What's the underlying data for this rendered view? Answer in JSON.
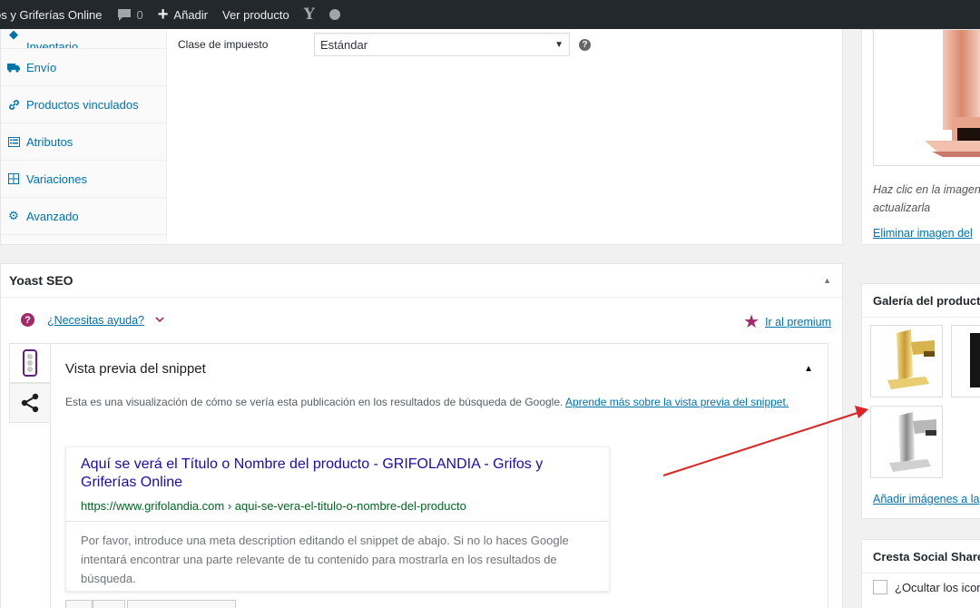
{
  "adminbar": {
    "site_name": "os y Griferías Online",
    "comments_count": "0",
    "add_label": "Añadir",
    "view_label": "Ver producto",
    "yoast_letter": "Y"
  },
  "product_tabs": [
    {
      "label": "Inventario",
      "icon": "diamond-icon"
    },
    {
      "label": "Envío",
      "icon": "truck-icon"
    },
    {
      "label": "Productos vinculados",
      "icon": "link-icon"
    },
    {
      "label": "Atributos",
      "icon": "list-icon"
    },
    {
      "label": "Variaciones",
      "icon": "grid-icon"
    },
    {
      "label": "Avanzado",
      "icon": "gear-icon"
    }
  ],
  "tax_field": {
    "label": "Clase de impuesto",
    "value": "Estándar",
    "help": "?"
  },
  "yoast": {
    "title": "Yoast SEO",
    "help_link": "¿Necesitas ayuda?",
    "premium_link": "Ir al premium",
    "snippet_title": "Vista previa del snippet",
    "description_text": "Esta es una visualización de cómo se vería esta publicación en los resultados de búsqueda de Google.",
    "description_link": "Aprende más sobre la vista previa del snippet.",
    "google": {
      "title": "Aquí se verá el Título o Nombre del producto - GRIFOLANDIA - Grifos y Griferías Online",
      "url": "https://www.grifolandia.com › aqui-se-vera-el-titulo-o-nombre-del-producto",
      "meta": "Por favor, introduce una meta description editando el snippet de abajo. Si no lo haces Google intentará encontrar una parte relevante de tu contenido para mostrarla en los resultados de búsqueda."
    }
  },
  "featured_image": {
    "note_line1": "Haz clic en la imagen",
    "note_line2": "actualizarla",
    "remove_link": "Eliminar imagen del"
  },
  "gallery": {
    "title": "Galería del product",
    "add_link": "Añadir imágenes a la",
    "thumbs": [
      "gold-faucet",
      "black-faucet",
      "chrome-faucet"
    ]
  },
  "social": {
    "title": "Cresta Social Share",
    "checkbox_label": "¿Ocultar los icono"
  },
  "colors": {
    "adminbar": "#23282d",
    "link": "#0073aa",
    "yoast_purple": "#a4286a",
    "google_title": "#1a0dab",
    "google_url": "#006621",
    "annotation_arrow": "#e02424"
  }
}
